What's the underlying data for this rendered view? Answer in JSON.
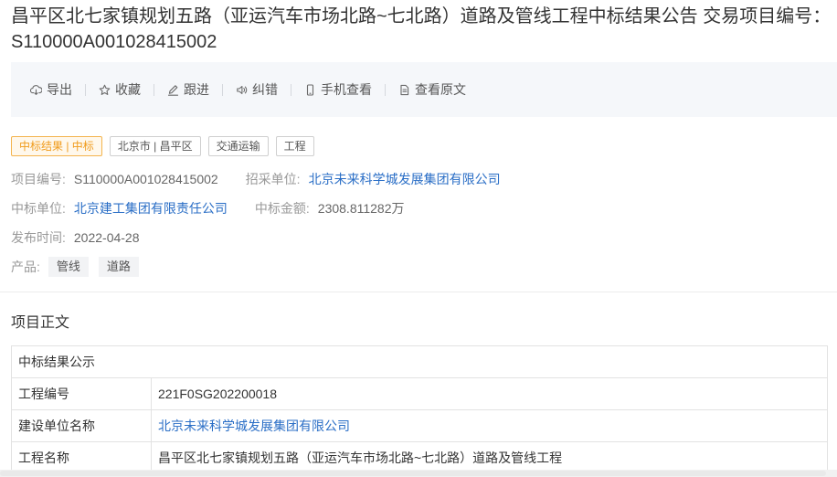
{
  "title": "昌平区北七家镇规划五路（亚运汽车市场北路~七北路）道路及管线工程中标结果公告 交易项目编号：S110000A001028415002",
  "toolbar": {
    "items": [
      {
        "label": "导出",
        "icon": "export-icon"
      },
      {
        "label": "收藏",
        "icon": "star-icon"
      },
      {
        "label": "跟进",
        "icon": "pen-icon"
      },
      {
        "label": "纠错",
        "icon": "speaker-icon"
      },
      {
        "label": "手机查看",
        "icon": "phone-icon"
      },
      {
        "label": "查看原文",
        "icon": "document-icon"
      }
    ]
  },
  "tags": [
    "中标结果 | 中标",
    "北京市 | 昌平区",
    "交通运输",
    "工程"
  ],
  "info": {
    "project_no": {
      "label": "项目编号:",
      "value": "S110000A001028415002"
    },
    "purchaser": {
      "label": "招采单位:",
      "value": "北京未来科学城发展集团有限公司"
    },
    "winner": {
      "label": "中标单位:",
      "value": "北京建工集团有限责任公司"
    },
    "amount": {
      "label": "中标金额:",
      "value": "2308.811282万"
    },
    "publish_date": {
      "label": "发布时间:",
      "value": "2022-04-28"
    },
    "products": {
      "label": "产品:",
      "items": [
        "管线",
        "道路"
      ]
    }
  },
  "section_title": "项目正文",
  "table": {
    "caption": "中标结果公示",
    "rows": [
      {
        "label": "工程编号",
        "value": "221F0SG202200018"
      },
      {
        "label": "建设单位名称",
        "value": "北京未来科学城发展集团有限公司"
      },
      {
        "label": "工程名称",
        "value": "昌平区北七家镇规划五路（亚运汽车市场北路~七北路）道路及管线工程"
      }
    ]
  },
  "colors": {
    "link": "#2a6ec6",
    "status_tag": "#f09b1c",
    "toolbar_bg": "#f5f7fa"
  }
}
